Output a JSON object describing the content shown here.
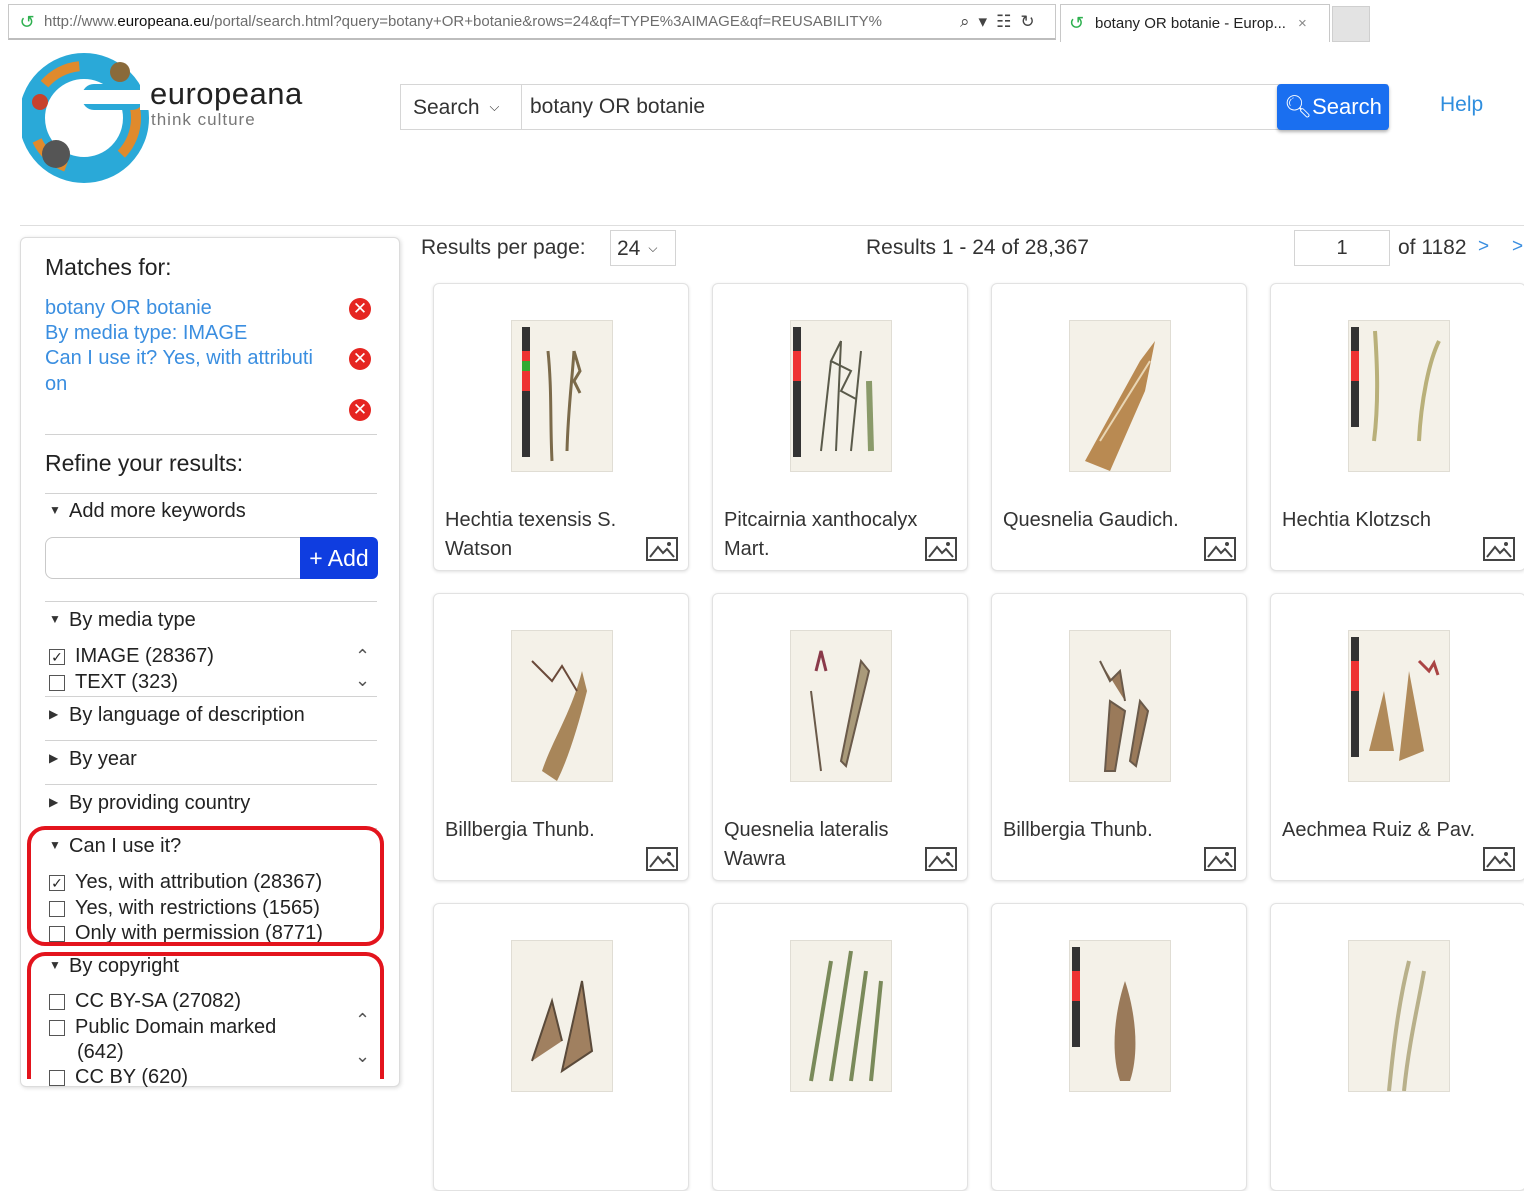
{
  "browser": {
    "url_prefix": "http://www.",
    "url_domain": "europeana.eu",
    "url_rest": "/portal/search.html?query=botany+OR+botanie&rows=24&qf=TYPE%3AIMAGE&qf=REUSABILITY%",
    "tab_title": "botany OR botanie - Europ...",
    "tab_close": "×"
  },
  "header": {
    "logo_name": "europeana",
    "logo_tagline": "think culture",
    "search_scope": "Search",
    "search_value": "botany OR botanie",
    "search_button": "Search",
    "help": "Help"
  },
  "sidebar": {
    "matches_title": "Matches for:",
    "matches": [
      "botany OR botanie",
      "By media type: IMAGE",
      "Can I use it? Yes, with attributi",
      "on"
    ],
    "refine_title": "Refine your results:",
    "add_keywords": "Add more keywords",
    "add_button": "+ Add",
    "media_type_title": "By media type",
    "media_types": [
      {
        "label": "IMAGE (28367)",
        "checked": true
      },
      {
        "label": "TEXT (323)",
        "checked": false
      }
    ],
    "language_title": "By language of description",
    "year_title": "By year",
    "country_title": "By providing country",
    "use_title": "Can I use it?",
    "use_options": [
      {
        "label": "Yes, with attribution (28367)",
        "checked": true
      },
      {
        "label": "Yes, with restrictions (1565)",
        "checked": false
      },
      {
        "label": "Only with permission (8771)",
        "checked": false
      }
    ],
    "copyright_title": "By copyright",
    "copyright_options": [
      {
        "label": "CC BY-SA (27082)",
        "checked": false
      },
      {
        "label": "Public Domain marked",
        "checked": false
      },
      {
        "label": "(642)",
        "checked": false
      },
      {
        "label": "CC BY (620)",
        "checked": false
      }
    ]
  },
  "results": {
    "per_page_label": "Results per page:",
    "per_page_value": "24",
    "count_text": "Results   1 - 24 of 28,367",
    "page_value": "1",
    "page_of": "of 1182",
    "next": ">",
    "last": ">"
  },
  "cards": [
    {
      "title": "Hechtia texensis S. Watson"
    },
    {
      "title": "Pitcairnia xanthocalyx Mart."
    },
    {
      "title": "Quesnelia Gaudich."
    },
    {
      "title": "Hechtia Klotzsch"
    },
    {
      "title": "Billbergia Thunb."
    },
    {
      "title": "Quesnelia lateralis Wawra"
    },
    {
      "title": "Billbergia Thunb."
    },
    {
      "title": "Aechmea Ruiz & Pav."
    },
    {
      "title": ""
    },
    {
      "title": ""
    },
    {
      "title": ""
    },
    {
      "title": ""
    }
  ],
  "colors": {
    "link": "#3a8ee0",
    "search_button": "#1a6ff0",
    "add_button": "#0f3de0",
    "remove": "#e52521",
    "highlight": "#e3141d"
  },
  "icons": [
    "refresh-icon",
    "search-icon",
    "dropdown-chevron-icon",
    "remove-filter-icon",
    "checkbox-icon",
    "image-type-icon"
  ]
}
